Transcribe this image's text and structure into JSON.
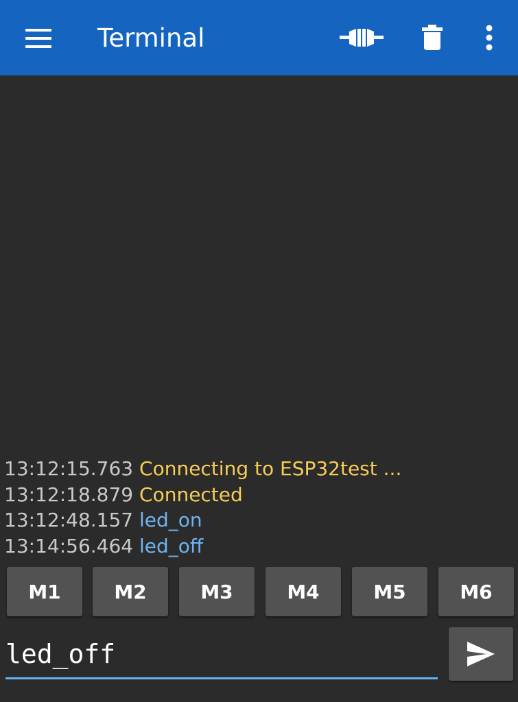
{
  "toolbar": {
    "title": "Terminal",
    "background_color": "#1565c0",
    "icons": [
      "menu-icon",
      "connect-icon",
      "delete-icon",
      "overflow-menu-icon"
    ]
  },
  "log": [
    {
      "time": "13:12:15.763",
      "message": "Connecting to ESP32test ...",
      "type": "status"
    },
    {
      "time": "13:12:18.879",
      "message": "Connected",
      "type": "status"
    },
    {
      "time": "13:12:48.157",
      "message": "led_on",
      "type": "sent"
    },
    {
      "time": "13:14:56.464",
      "message": "led_off",
      "type": "sent"
    }
  ],
  "colors": {
    "status_text": "#f8cd55",
    "sent_text": "#6fb3f0",
    "timestamp_text": "#c9c9c9",
    "background": "#2b2b2b",
    "input_underline": "#64b5f6"
  },
  "macros": [
    "M1",
    "M2",
    "M3",
    "M4",
    "M5",
    "M6"
  ],
  "input": {
    "value": "led_off"
  },
  "send": {
    "icon": "send-icon"
  }
}
